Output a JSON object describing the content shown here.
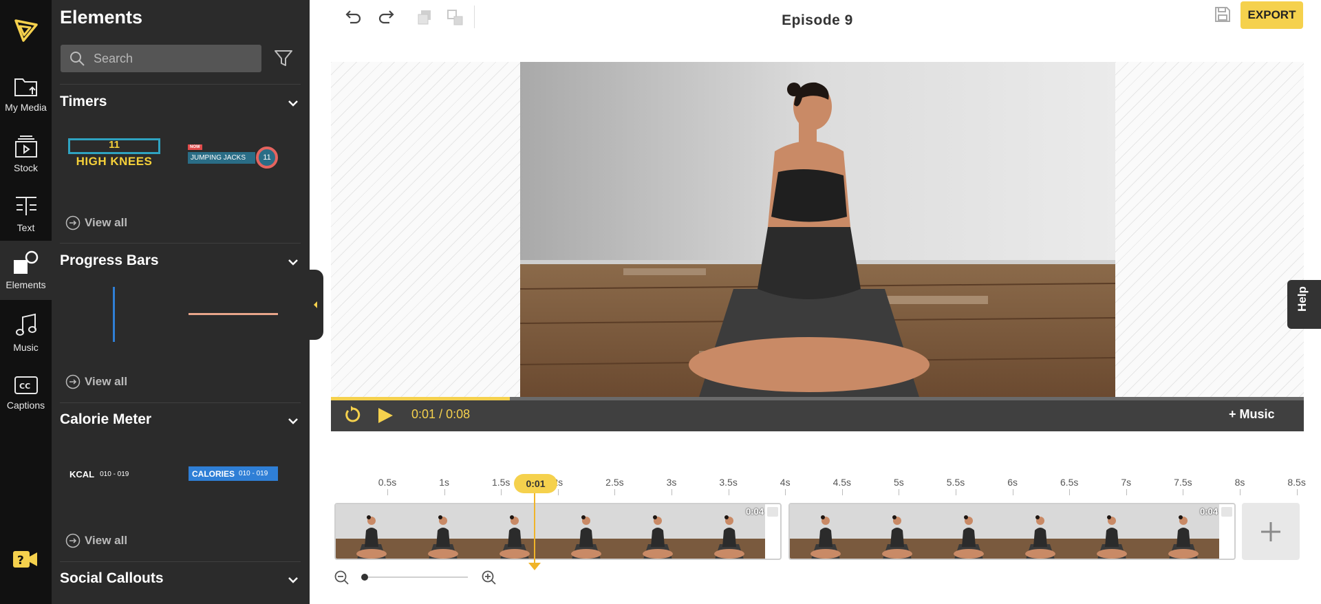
{
  "app": {
    "accent_color": "#f5d14d",
    "rail_color": "#111111",
    "panel_color": "#2b2b2b"
  },
  "rail": {
    "items": [
      {
        "label": "My Media",
        "icon": "folder-upload-icon"
      },
      {
        "label": "Stock",
        "icon": "stock-video-icon"
      },
      {
        "label": "Text",
        "icon": "text-icon"
      },
      {
        "label": "Elements",
        "icon": "elements-shapes-icon",
        "active": true
      },
      {
        "label": "Music",
        "icon": "music-note-icon"
      },
      {
        "label": "Captions",
        "icon": "closed-captions-icon"
      }
    ]
  },
  "panel": {
    "title": "Elements",
    "search_placeholder": "Search",
    "sections": [
      {
        "title": "Timers",
        "view_all": "View all",
        "thumbnails": {
          "timer1_number": "11",
          "timer1_text": "HIGH KNEES",
          "timer2_badge": "NOW",
          "timer2_text": "JUMPING JACKS",
          "timer2_number": "11"
        }
      },
      {
        "title": "Progress Bars",
        "view_all": "View all",
        "thumbnails": {
          "bar1_color": "#2f7fd6",
          "bar2_color": "#e8a58a"
        }
      },
      {
        "title": "Calorie Meter",
        "view_all": "View all",
        "thumbnails": {
          "cal1_label": "KCAL",
          "cal1_range": "010 - 019",
          "cal2_label": "CALORIES",
          "cal2_range": "010 - 019"
        }
      },
      {
        "title": "Social Callouts"
      }
    ]
  },
  "topbar": {
    "title": "Episode 9",
    "export_label": "EXPORT"
  },
  "player": {
    "current_time": "0:01",
    "separator": "/",
    "duration": "0:08",
    "progress_fraction": 0.184,
    "music_label": "+ Music",
    "help_label": "Help"
  },
  "timeline": {
    "ruler": [
      "0.5s",
      "1s",
      "1.5s",
      "2s",
      "2.5s",
      "3s",
      "3.5s",
      "4s",
      "4.5s",
      "5s",
      "5.5s",
      "6s",
      "6.5s",
      "7s",
      "7.5s",
      "8s",
      "8.5s"
    ],
    "playhead_label": "0:01",
    "clips": [
      {
        "duration": "0:04"
      },
      {
        "duration": "0:04"
      }
    ]
  }
}
